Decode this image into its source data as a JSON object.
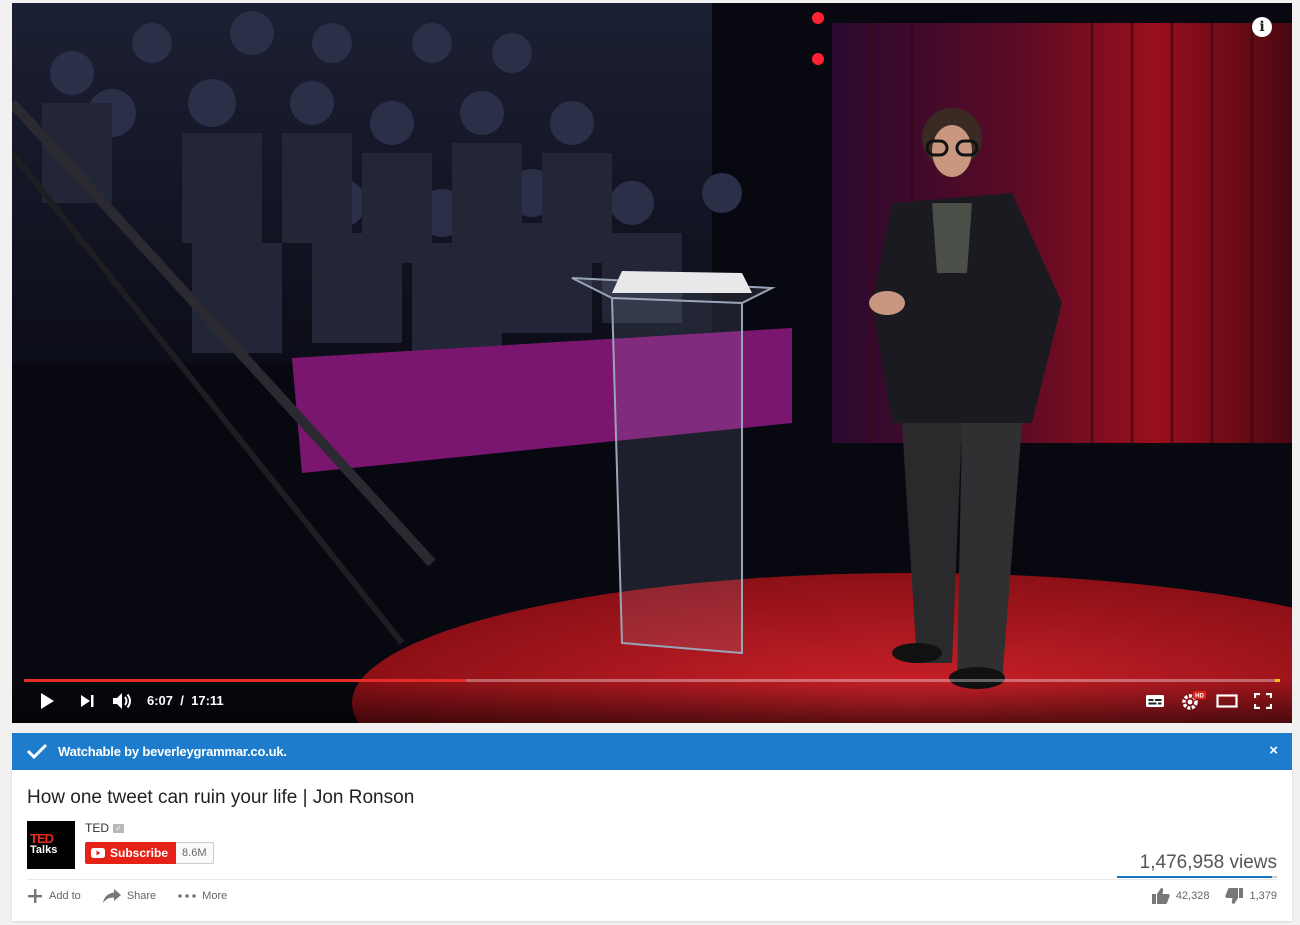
{
  "player": {
    "time_current": "6:07",
    "time_total": "17:11",
    "progress_played_fraction": 0.352,
    "info_icon": "info-icon",
    "colors": {
      "played": "#e52d27",
      "buffer": "#f5c400"
    }
  },
  "banner": {
    "message": "Watchable by beverleygrammar.co.uk.",
    "close": "×",
    "color": "#1e7ccd"
  },
  "video": {
    "title": "How one tweet can ruin your life | Jon Ronson",
    "channel": "TED",
    "avatar_line1": "TED",
    "avatar_line2": "Talks",
    "subscribe_label": "Subscribe",
    "subscriber_count": "8.6M",
    "views": "1,476,958 views",
    "likes": "42,328",
    "dislikes": "1,379",
    "like_fraction": 0.968
  },
  "actions": {
    "add_to": "Add to",
    "share": "Share",
    "more": "More"
  },
  "hd_badge": "HD"
}
